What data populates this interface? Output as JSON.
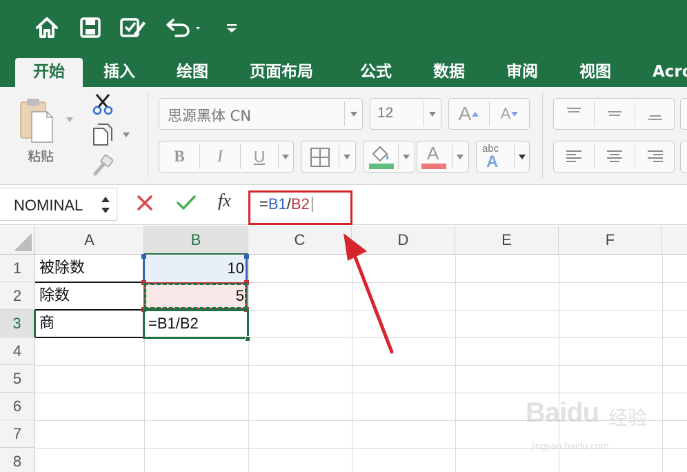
{
  "quick_access": {
    "icons": [
      "home-icon",
      "save-icon",
      "edit-icon",
      "undo-icon",
      "customize-icon"
    ]
  },
  "tabs": [
    "开始",
    "插入",
    "绘图",
    "页面布局",
    "公式",
    "数据",
    "审阅",
    "视图",
    "Acro"
  ],
  "ribbon": {
    "paste_label": "粘贴",
    "font_name": "思源黑体 CN",
    "font_size": "12",
    "bold": "B",
    "italic": "I",
    "underline": "U",
    "grow_font": "A",
    "shrink_font": "A",
    "font_color_letter": "A",
    "text_effect_label": "abc",
    "text_effect_letter": "A",
    "fill_color": "#5fc07f",
    "font_color": "#f0787d"
  },
  "formula_bar": {
    "name_box": "NOMINAL",
    "fx_label": "fx",
    "formula_eq": "=",
    "formula_ref1": "B1",
    "formula_slash": "/",
    "formula_ref2": "B2"
  },
  "sheet": {
    "columns": [
      "A",
      "B",
      "C",
      "D",
      "E",
      "F"
    ],
    "rows": [
      "1",
      "2",
      "3",
      "4",
      "5",
      "6",
      "7",
      "8"
    ],
    "cells": {
      "A1": "被除数",
      "A2": "除数",
      "A3": "商",
      "B1": "10",
      "B2": "5",
      "B3": "=B1/B2"
    }
  },
  "colors": {
    "excel_green": "#207245",
    "ref_blue": "#3164b8",
    "ref_red": "#b8373d",
    "annotation_red": "#d6262d"
  },
  "watermark": {
    "logo": "Bai",
    "logo_suffix": "du",
    "cn": "经验",
    "url": "jingyan.baidu.com"
  }
}
